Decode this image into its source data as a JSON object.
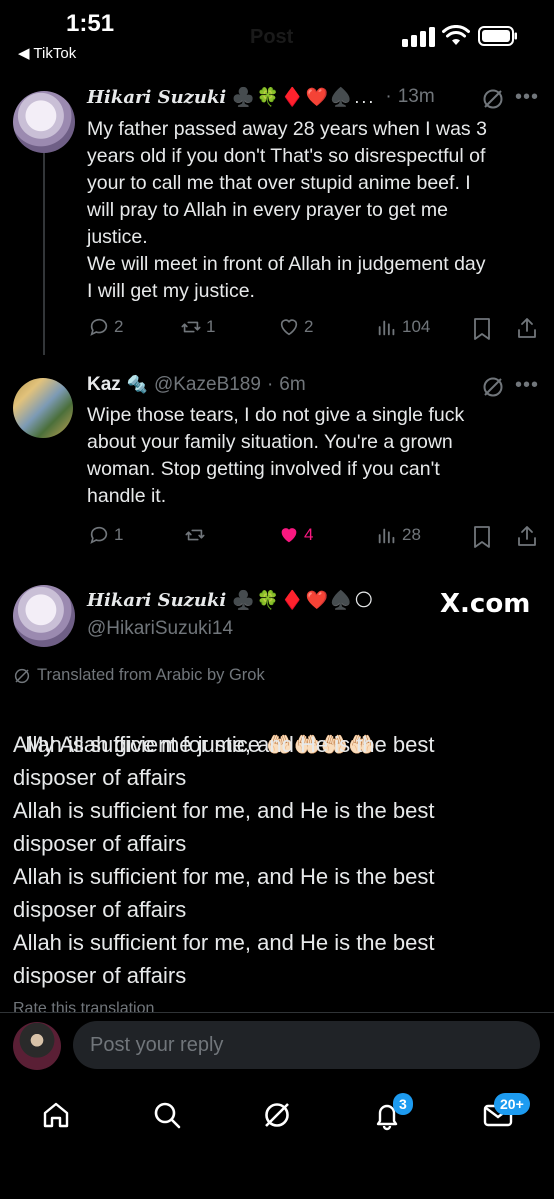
{
  "status_bar": {
    "time": "1:51",
    "back_label": "◀ TikTok",
    "ghost_title": "Post"
  },
  "post1": {
    "name": "Hikari Suzuki",
    "emojis": "♣️🍀♦️❤️♠️...",
    "time": "13m",
    "text": "My father passed away 28 years when I was 3\nyears old if you don't That's so disrespectful of\nyour to call me that over stupid anime beef. I\nwill pray to Allah in every prayer to get me\njustice.\nWe will meet in front of Allah in judgement day\nI will get my justice.",
    "replies": "2",
    "reposts": "1",
    "likes": "2",
    "views": "104"
  },
  "post2": {
    "name": "Kaz",
    "name_emoji": "🔩",
    "handle": "@KazeB189",
    "time": "6m",
    "text": "Wipe those tears, I do not give a single fuck\nabout your family situation. You're a grown\nwoman. Stop getting involved if you can't\nhandle it.",
    "replies": "1",
    "likes": "4",
    "views": "28"
  },
  "main_post": {
    "name": "Hikari Suzuki",
    "emojis": "♣️🍀♦️❤️♠️🌕",
    "handle": "@HikariSuzuki14",
    "watermark": "X.com",
    "translated_label": "Translated from Arabic by Grok",
    "text_line1": "My Allah give me justice",
    "hands": "🤲🏻🤲🏻🤲🏻🤲🏻",
    "text_rest": "Allah is sufficient for me, and He is the best\ndisposer of affairs\nAllah is sufficient for me, and He is the best\ndisposer of affairs\nAllah is sufficient for me, and He is the best\ndisposer of affairs\nAllah is sufficient for me, and He is the best\ndisposer of affairs",
    "rate_label": "Rate this translation"
  },
  "reply": {
    "placeholder": "Post your reply"
  },
  "tabbar": {
    "notifications_badge": "3",
    "messages_badge": "20+"
  },
  "colors": {
    "like": "#f91880",
    "badge": "#1d9bf0",
    "muted": "#71767b"
  }
}
